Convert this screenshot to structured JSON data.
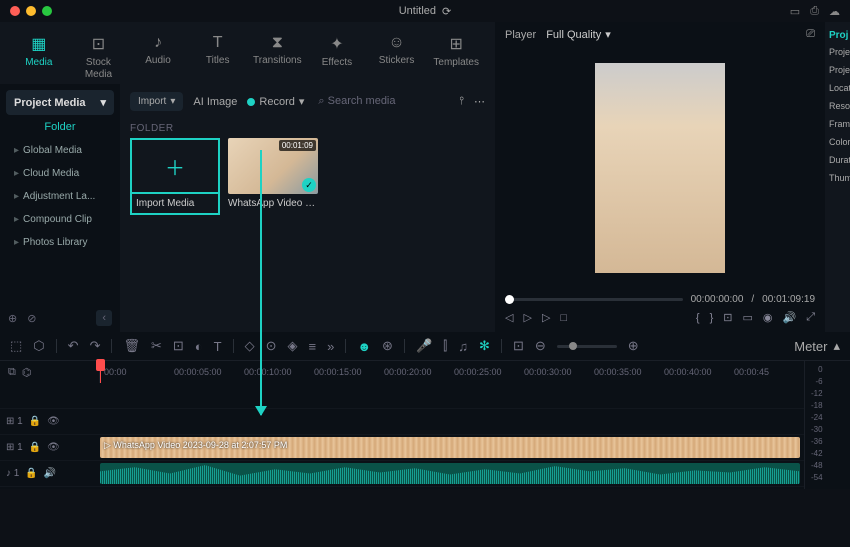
{
  "title": "Untitled",
  "tabs": [
    "Media",
    "Stock Media",
    "Audio",
    "Titles",
    "Transitions",
    "Effects",
    "Stickers",
    "Templates"
  ],
  "sidebar": {
    "head": "Project Media",
    "sub": "Folder",
    "items": [
      "Global Media",
      "Cloud Media",
      "Adjustment La...",
      "Compound Clip",
      "Photos Library"
    ]
  },
  "toolbar": {
    "import": "Import",
    "ai_image": "AI Image",
    "record": "Record",
    "search_placeholder": "Search media"
  },
  "folder_label": "FOLDER",
  "tiles": {
    "import_label": "Import Media",
    "clip_label": "WhatsApp Video 202…",
    "clip_duration": "00:01:09"
  },
  "preview": {
    "player_label": "Player",
    "quality": "Full Quality",
    "current": "00:00:00:00",
    "sep": "/",
    "total": "00:01:09:19"
  },
  "props": {
    "title": "Proj",
    "rows": [
      "Proje",
      "Proje",
      "Locat",
      "Reso",
      "Fram",
      "Color",
      "Durat",
      "Thum"
    ]
  },
  "timeline": {
    "meter_label": "Meter",
    "ticks": [
      "00:00",
      "00:00:05:00",
      "00:00:10:00",
      "00:00:15:00",
      "00:00:20:00",
      "00:00:25:00",
      "00:00:30:00",
      "00:00:35:00",
      "00:00:40:00",
      "00:00:45"
    ],
    "clip_name": "WhatsApp Video 2023-09-28 at 2:07:57 PM",
    "db": [
      "0",
      "-6",
      "-12",
      "-18",
      "-24",
      "-30",
      "-36",
      "-42",
      "-48",
      "-54"
    ],
    "track_labels": {
      "pip": "⊞ 1",
      "main": "⊞ 1",
      "audio": "♪ 1"
    }
  }
}
